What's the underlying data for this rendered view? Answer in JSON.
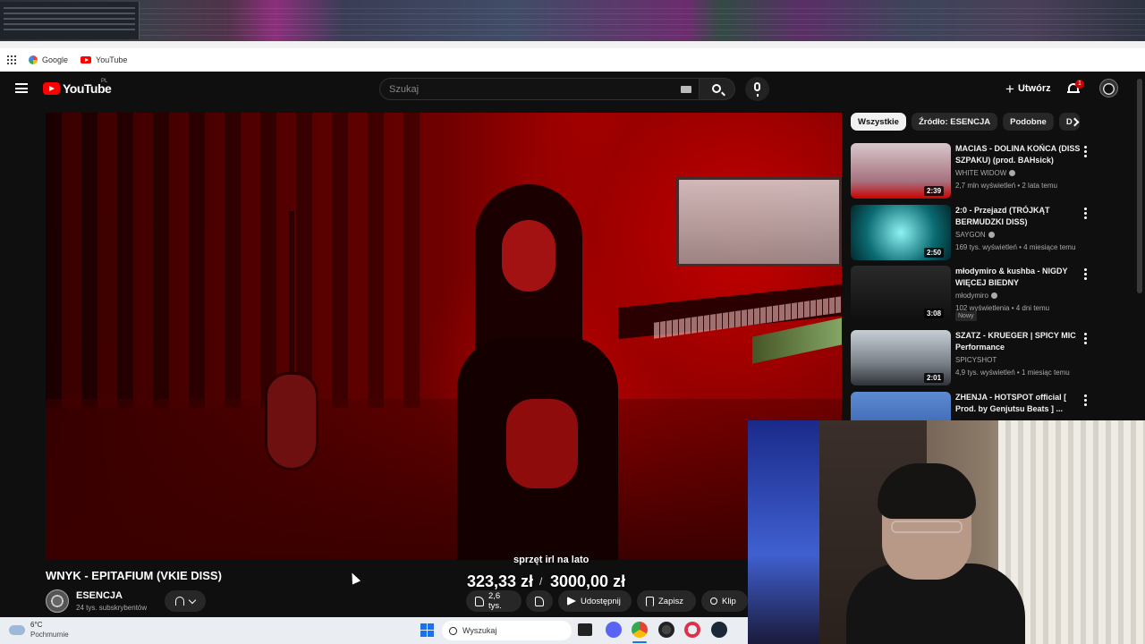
{
  "bookmarks": [
    {
      "label": "Google"
    },
    {
      "label": "YouTube"
    }
  ],
  "header": {
    "region": "PL",
    "search_placeholder": "Szukaj",
    "create_label": "Utwórz",
    "notification_count": "1"
  },
  "video": {
    "title": "WNYK - EPITAFIUM (VKIE DISS)",
    "channel": "ESENCJA",
    "subscribers": "24 tys. subskrybentów",
    "likes": "2,6 tys.",
    "share_label": "Udostępnij",
    "save_label": "Zapisz",
    "clip_label": "Klip"
  },
  "donation": {
    "label": "sprzęt irl na lato",
    "current": "323,33 zł",
    "separator": "/",
    "goal": "3000,00 zł"
  },
  "chips": [
    "Wszystkie",
    "Źródło: ESENCJA",
    "Podobne",
    "D"
  ],
  "recommendations": [
    {
      "title": "MACIAS - DOLINA KOŃCA (DISS SZPAKU) (prod. BAHsick)",
      "channel": "WHITE WIDOW",
      "meta": "2,7 mln wyświetleń • 2 lata temu",
      "duration": "2:39"
    },
    {
      "title": "2:0 - Przejazd (TRÓJKĄT BERMUDZKI DISS)",
      "channel": "SAYGON",
      "meta": "169 tys. wyświetleń • 4 miesiące temu",
      "duration": "2:50"
    },
    {
      "title": "młodymiro & kushba - NIGDY WIĘCEJ BIEDNY",
      "channel": "młodymiro",
      "meta": "102 wyświetlenia • 4 dni temu",
      "duration": "3:08",
      "badge": "Nowy"
    },
    {
      "title": "SZATZ - KRUEGER | SPICY MIC Performance",
      "channel": "SPICYSHOT",
      "meta": "4,9 tys. wyświetleń • 1 miesiąc temu",
      "duration": "2:01"
    },
    {
      "title": "ZHENJA - HOTSPOT official [ Prod. by Genjutsu Beats ] ...",
      "channel": "",
      "meta": "",
      "duration": ""
    }
  ],
  "taskbar": {
    "temperature": "6°C",
    "weather": "Pochmurnie",
    "search_placeholder": "Wyszukaj"
  }
}
